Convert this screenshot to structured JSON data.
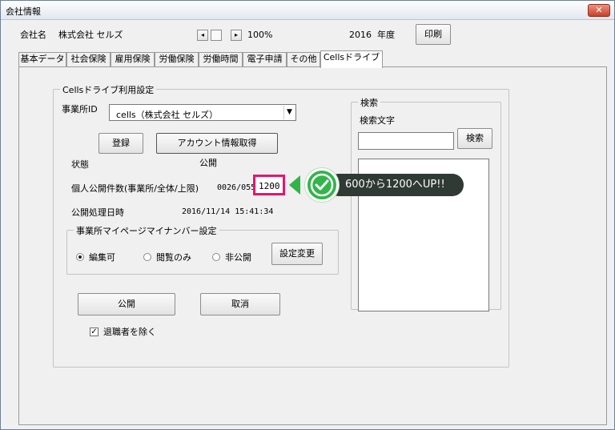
{
  "window": {
    "title": "会社情報",
    "close_glyph": "✕"
  },
  "header": {
    "company_label": "会社名",
    "company_name": "株式会社 セルズ",
    "zoom_left": "◂",
    "zoom_right": "▸",
    "zoom": "100%",
    "year": "2016",
    "year_label": "年度",
    "print_label": "印刷"
  },
  "tabs": [
    {
      "label": "基本データ"
    },
    {
      "label": "社会保険"
    },
    {
      "label": "雇用保険"
    },
    {
      "label": "労働保険"
    },
    {
      "label": "労働時間"
    },
    {
      "label": "電子申請"
    },
    {
      "label": "その他"
    },
    {
      "label": "Cellsドライブ",
      "active": true
    }
  ],
  "settings": {
    "group_title": "Cellsドライブ利用設定",
    "office_id_label": "事業所ID",
    "office_id_value": "cells（株式会社 セルズ）",
    "register_label": "登録",
    "account_label": "アカウント情報取得",
    "status_label": "状態",
    "status_value": "公開",
    "count_label": "個人公開件数(事業所/全体/上限)",
    "count_value": "0026/0555/",
    "count_limit": "1200",
    "published_label": "公開処理日時",
    "published_value": "2016/11/14 15:41:34"
  },
  "mynumber": {
    "group_title": "事業所マイページマイナンバー設定",
    "options": [
      {
        "label": "編集可",
        "selected": true
      },
      {
        "label": "閲覧のみ",
        "selected": false
      },
      {
        "label": "非公開",
        "selected": false
      }
    ],
    "change_label": "設定変更"
  },
  "actions": {
    "publish_label": "公開",
    "cancel_label": "取消",
    "exclude_retired_label": "退職者を除く",
    "exclude_retired_checked": true,
    "check_glyph": "✓"
  },
  "search": {
    "group_title": "検索",
    "text_label": "検索文字",
    "input_value": "",
    "button_label": "検索"
  },
  "callout": {
    "text": "600から1200へUP!!",
    "accent_color": "#32b54a",
    "highlight_color": "#e8156b"
  }
}
